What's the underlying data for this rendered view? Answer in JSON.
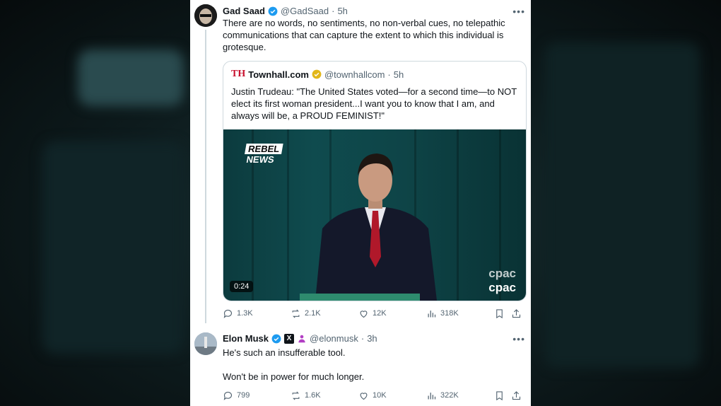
{
  "tweets": [
    {
      "author_name": "Gad Saad",
      "handle": "@GadSaad",
      "time": "5h",
      "text": "There are no words, no sentiments, no non-verbal cues, no telepathic communications that can capture the extent to which this individual is grotesque.",
      "quote": {
        "logo": "TH",
        "author_name": "Townhall.com",
        "handle": "@townhallcom",
        "time": "5h",
        "text": "Justin Trudeau: \"The United States voted—for a second time—to NOT elect its first woman president...I want you to know that I am, and always will be, a PROUD FEMINIST!\"",
        "video": {
          "watermark_line1": "REBEL",
          "watermark_line2": "NEWS",
          "duration": "0:24",
          "network_logo": "cpac"
        }
      },
      "stats": {
        "replies": "1.3K",
        "reposts": "2.1K",
        "likes": "12K",
        "views": "318K"
      }
    },
    {
      "author_name": "Elon Musk",
      "handle": "@elonmusk",
      "time": "3h",
      "text_line1": "He's such an insufferable tool.",
      "text_line2": "Won't be in power for much longer.",
      "stats": {
        "replies": "799",
        "reposts": "1.6K",
        "likes": "10K",
        "views": "322K"
      }
    }
  ],
  "colors": {
    "verified_blue": "#1d9bf0",
    "verified_gold": "#e2b719",
    "text": "#0f1419",
    "muted": "#536471",
    "townhall_red": "#c8102e"
  },
  "icons": [
    "more-icon",
    "reply-icon",
    "repost-icon",
    "like-icon",
    "views-icon",
    "bookmark-icon",
    "share-icon",
    "verified-badge-icon",
    "x-affiliate-icon"
  ]
}
